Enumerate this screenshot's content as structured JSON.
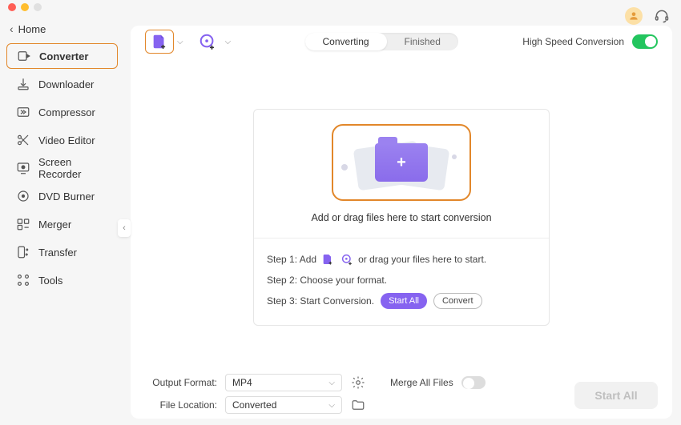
{
  "titlebar": {
    "has_traffic_lights": true
  },
  "sidebar": {
    "back_label": "Home",
    "items": [
      {
        "label": "Converter",
        "icon": "convert-icon",
        "active": true
      },
      {
        "label": "Downloader",
        "icon": "download-icon"
      },
      {
        "label": "Compressor",
        "icon": "compress-icon"
      },
      {
        "label": "Video Editor",
        "icon": "scissors-icon"
      },
      {
        "label": "Screen Recorder",
        "icon": "screen-rec-icon"
      },
      {
        "label": "DVD Burner",
        "icon": "dvd-icon"
      },
      {
        "label": "Merger",
        "icon": "merger-icon"
      },
      {
        "label": "Transfer",
        "icon": "transfer-icon"
      },
      {
        "label": "Tools",
        "icon": "tools-icon"
      }
    ]
  },
  "toolbar": {
    "tabs": {
      "converting": "Converting",
      "finished": "Finished"
    },
    "high_speed_label": "High Speed Conversion",
    "high_speed_on": true
  },
  "drop": {
    "instruction": "Add or drag files here to start conversion"
  },
  "steps": {
    "s1_pre": "Step 1: Add ",
    "s1_post": " or drag your files here to start.",
    "s2": "Step 2: Choose your format.",
    "s3_pre": "Step 3: Start Conversion.",
    "start_all_mini": "Start  All",
    "convert_mini": "Convert"
  },
  "footer": {
    "output_format_label": "Output Format:",
    "output_format_value": "MP4",
    "file_location_label": "File Location:",
    "file_location_value": "Converted",
    "merge_label": "Merge All Files",
    "merge_on": false,
    "start_all_label": "Start All"
  }
}
